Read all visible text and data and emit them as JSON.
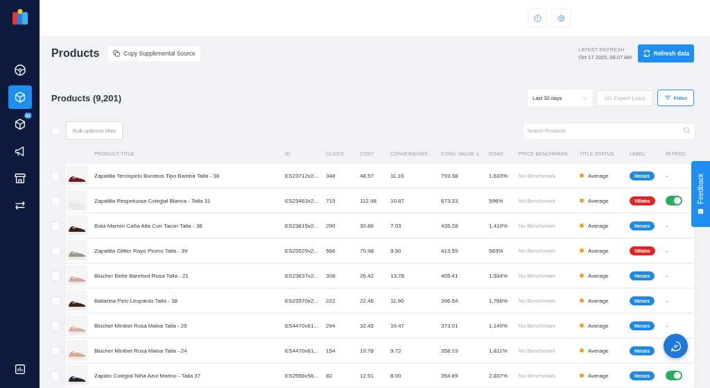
{
  "sidebar": {
    "items": [
      {
        "selected": false
      },
      {
        "selected": true
      },
      {
        "selected": false,
        "badge": "AI"
      },
      {
        "selected": false
      },
      {
        "selected": false
      },
      {
        "selected": false
      }
    ]
  },
  "header": {
    "title": "Products",
    "copy_button": "Copy Supplemental Source",
    "refresh_label": "LATEST REFRESH",
    "refresh_time": "Oct 17 2025, 08:07 AM",
    "refresh_button": "Refresh data"
  },
  "products": {
    "title": "Products (9,201)",
    "range": "Last 30 days",
    "export_button": "Export (.csv)",
    "export_disabled": true,
    "filter_button": "Filter",
    "bulk_button": "Bulk optimize titles",
    "select_all_checked": false,
    "search": {
      "placeholder": "Search Products"
    }
  },
  "table": {
    "columns": [
      {
        "label": "PRODUCT TITLE",
        "sorted": false
      },
      {
        "label": "ID",
        "sorted": false
      },
      {
        "label": "CLICKS",
        "sorted": false
      },
      {
        "label": "COST",
        "sorted": false
      },
      {
        "label": "CONVERSIONS",
        "sorted": false
      },
      {
        "label": "CONV. VALUE",
        "sorted": true
      },
      {
        "label": "ROAS",
        "sorted": false
      },
      {
        "label": "PRICE BENCHMARK",
        "sorted": false
      },
      {
        "label": "TITLE STATUS",
        "sorted": false
      },
      {
        "label": "LABEL",
        "sorted": false
      },
      {
        "label": "IN FEED",
        "sorted": false
      }
    ],
    "rows": [
      {
        "checked": false,
        "title": "Zapatilla Terciopelo Burdeos Tipo Bamba Talla - 38",
        "id": "ES23712v2...",
        "clicks": "348",
        "cost": "48.57",
        "conversions": "11.16",
        "conv_value": "793.38",
        "roas": "1,633%",
        "benchmark": "No Benchmark",
        "status": {
          "text": "Average",
          "color": "#f0a030"
        },
        "label": {
          "text": "Heroes",
          "color": "#1e88e5"
        },
        "in_feed": {
          "kind": "dash",
          "text": "-"
        }
      },
      {
        "checked": false,
        "title": "Zapatilla Respetuosa Colegial Blanca - Talla 31",
        "id": "ES23463v2...",
        "clicks": "715",
        "cost": "112.98",
        "conversions": "10.87",
        "conv_value": "673.33",
        "roas": "596%",
        "benchmark": "No Benchmark",
        "status": {
          "text": "Average",
          "color": "#f0a030"
        },
        "label": {
          "text": "Villains",
          "color": "#e02424"
        },
        "in_feed": {
          "kind": "switch",
          "on": true
        }
      },
      {
        "checked": false,
        "title": "Bota Marrón Caña Alta Con Tacón Talla - 38",
        "id": "ES23615v2...",
        "clicks": "290",
        "cost": "30.86",
        "conversions": "7.03",
        "conv_value": "435.28",
        "roas": "1,410%",
        "benchmark": "No Benchmark",
        "status": {
          "text": "Average",
          "color": "#f0a030"
        },
        "label": {
          "text": "Heroes",
          "color": "#1e88e5"
        },
        "in_feed": {
          "kind": "dash",
          "text": "-"
        }
      },
      {
        "checked": false,
        "title": "Zapatilla Glitter Rayo Plomo Talla - 39",
        "id": "ES23529v2...",
        "clicks": "566",
        "cost": "70.98",
        "conversions": "9.50",
        "conv_value": "413.59",
        "roas": "583%",
        "benchmark": "No Benchmark",
        "status": {
          "text": "Average",
          "color": "#f0a030"
        },
        "label": {
          "text": "Villains",
          "color": "#e02424"
        },
        "in_feed": {
          "kind": "dash",
          "text": "-"
        }
      },
      {
        "checked": false,
        "title": "Blucher Bebé Barefoot Rosa Talla - 21",
        "id": "ES23637v2...",
        "clicks": "308",
        "cost": "26.42",
        "conversions": "13.78",
        "conv_value": "405.41",
        "roas": "1,534%",
        "benchmark": "No Benchmark",
        "status": {
          "text": "Average",
          "color": "#f0a030"
        },
        "label": {
          "text": "Heroes",
          "color": "#1e88e5"
        },
        "in_feed": {
          "kind": "dash",
          "text": "-"
        }
      },
      {
        "checked": false,
        "title": "Bailarina Pelo Leopardo Talla - 38",
        "id": "ES23570v2...",
        "clicks": "222",
        "cost": "22.46",
        "conversions": "11.90",
        "conv_value": "396.54",
        "roas": "1,766%",
        "benchmark": "No Benchmark",
        "status": {
          "text": "Average",
          "color": "#f0a030"
        },
        "label": {
          "text": "Heroes",
          "color": "#1e88e5"
        },
        "in_feed": {
          "kind": "dash",
          "text": "-"
        }
      },
      {
        "checked": false,
        "title": "Blucher Minibel Rosa Malva Talla - 25",
        "id": "ES4470v61...",
        "clicks": "294",
        "cost": "32.45",
        "conversions": "10.47",
        "conv_value": "373.01",
        "roas": "1,149%",
        "benchmark": "No Benchmark",
        "status": {
          "text": "Average",
          "color": "#f0a030"
        },
        "label": {
          "text": "Heroes",
          "color": "#1e88e5"
        },
        "in_feed": {
          "kind": "dash",
          "text": "-"
        }
      },
      {
        "checked": false,
        "title": "Blucher Minibel Rosa Malva Talla - 24",
        "id": "ES4470v61...",
        "clicks": "154",
        "cost": "19.78",
        "conversions": "9.72",
        "conv_value": "358.19",
        "roas": "1,811%",
        "benchmark": "No Benchmark",
        "status": {
          "text": "Average",
          "color": "#f0a030"
        },
        "label": {
          "text": "Heroes",
          "color": "#1e88e5"
        }
      },
      {
        "checked": false,
        "title": "Zapato Colegial Niña Azul Marino - Talla 37",
        "id": "ES2556v56...",
        "clicks": "82",
        "cost": "12.51",
        "conversions": "8.00",
        "conv_value": "354.89",
        "roas": "2,837%",
        "benchmark": "No Benchmark",
        "status": {
          "text": "Average",
          "color": "#f0a030"
        },
        "label": {
          "text": "Heroes",
          "color": "#1e88e5"
        },
        "in_feed": {
          "kind": "switch",
          "on": true
        }
      }
    ]
  },
  "feedback_tab": "Feedback"
}
